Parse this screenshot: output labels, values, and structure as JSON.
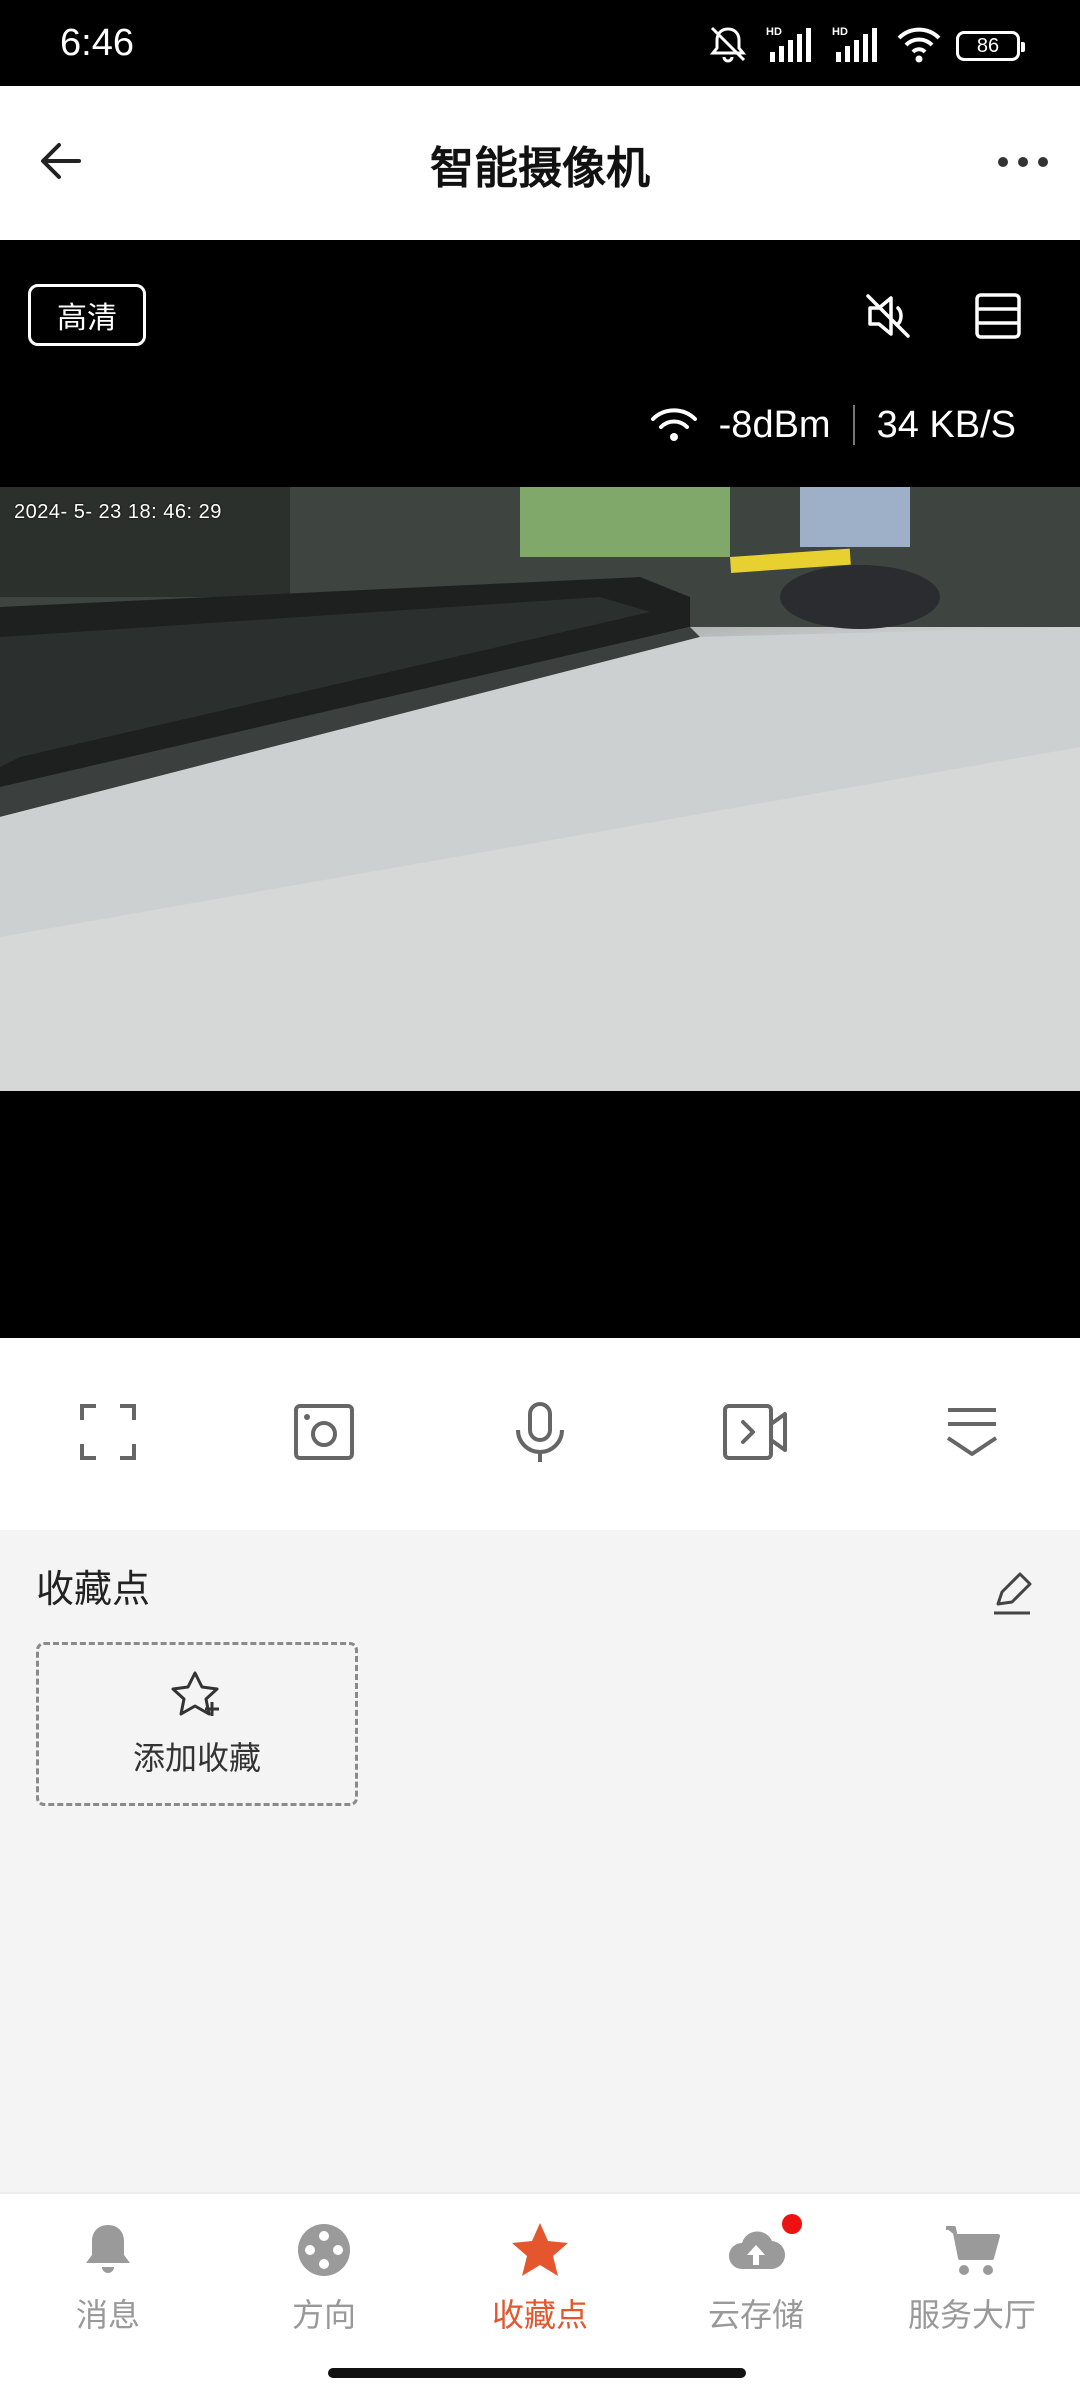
{
  "status_bar": {
    "time": "6:46",
    "battery": "86",
    "icons": [
      "mute-bell-icon",
      "hd-signal-icon",
      "hd-signal-icon",
      "wifi-icon",
      "battery-icon"
    ]
  },
  "header": {
    "title": "智能摄像机",
    "back_icon": "back-arrow-icon",
    "more_icon": "more-dots-icon"
  },
  "video": {
    "quality_label": "高清",
    "signal": "-8dBm",
    "speed": "34 KB/S",
    "timestamp": "2024- 5- 23  18: 46: 29"
  },
  "controls": [
    {
      "name": "fullscreen",
      "icon": "fullscreen-icon"
    },
    {
      "name": "snapshot",
      "icon": "snapshot-icon"
    },
    {
      "name": "talk",
      "icon": "microphone-icon"
    },
    {
      "name": "record",
      "icon": "video-record-icon"
    },
    {
      "name": "more",
      "icon": "expand-panel-icon"
    }
  ],
  "favorites": {
    "title": "收藏点",
    "add_label": "添加收藏"
  },
  "nav": [
    {
      "label": "消息",
      "icon": "bell-icon",
      "active": false
    },
    {
      "label": "方向",
      "icon": "direction-pad-icon",
      "active": false
    },
    {
      "label": "收藏点",
      "icon": "star-icon",
      "active": true
    },
    {
      "label": "云存储",
      "icon": "cloud-upload-icon",
      "active": false,
      "badge": true
    },
    {
      "label": "服务大厅",
      "icon": "cart-icon",
      "active": false
    }
  ],
  "colors": {
    "accent": "#e4572e",
    "inactive": "#999999",
    "badge": "#ee1111"
  }
}
